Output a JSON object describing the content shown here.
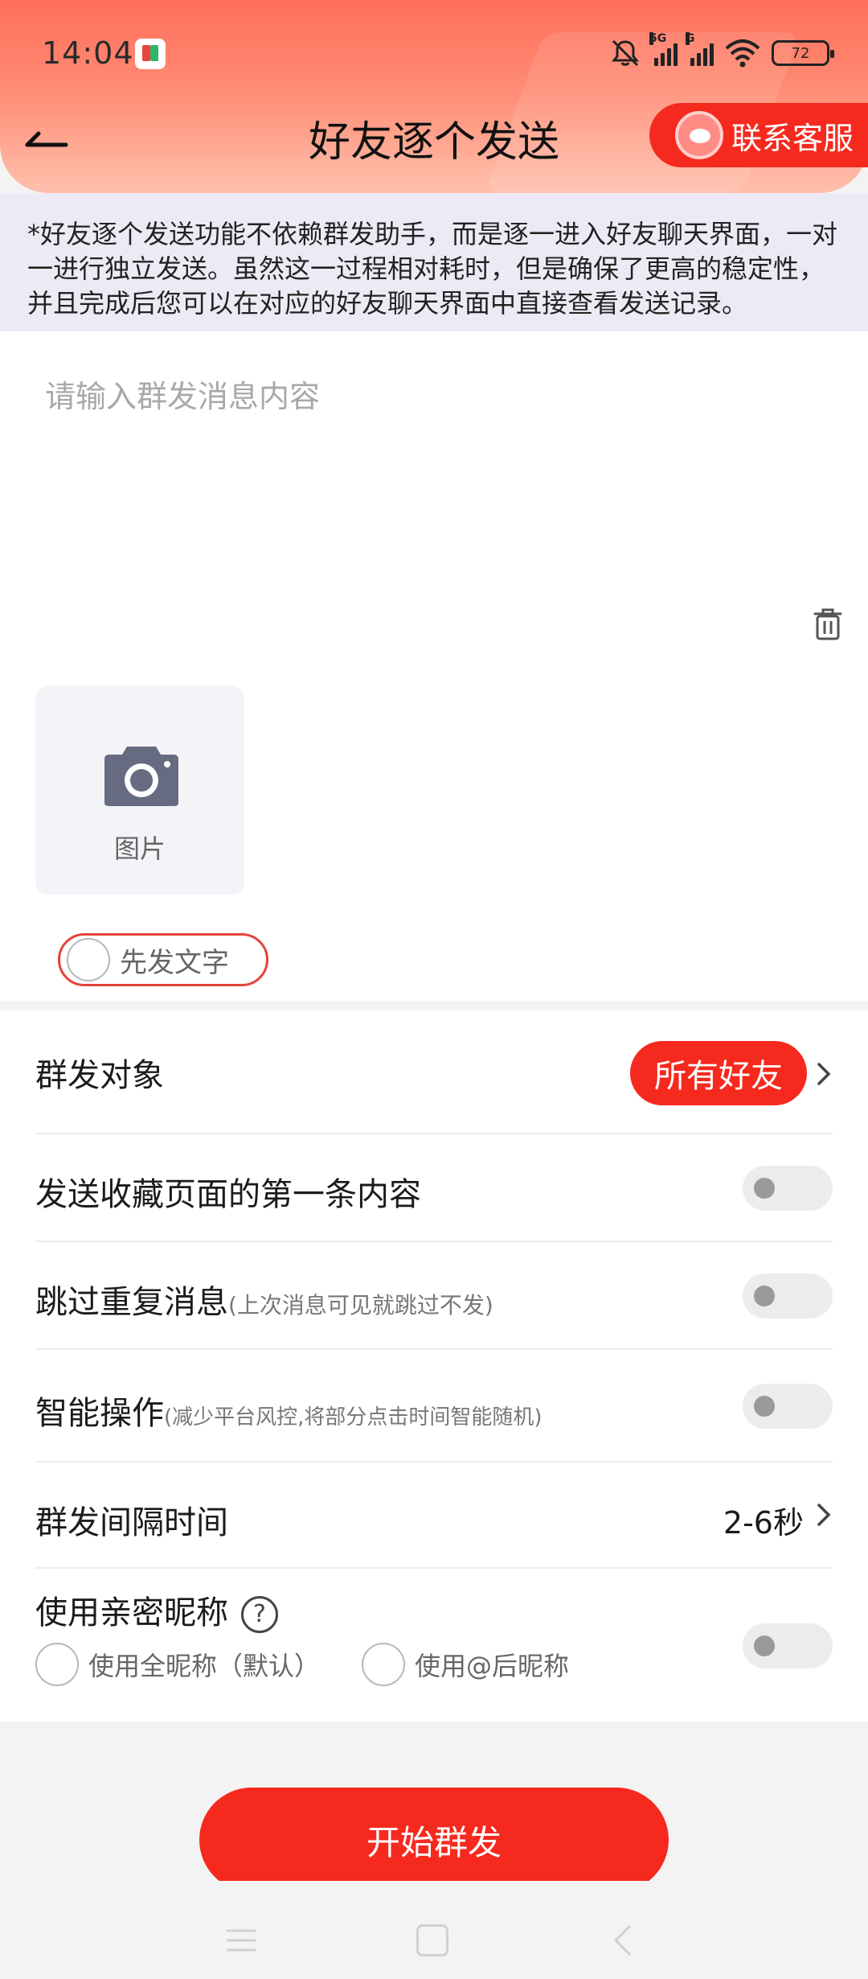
{
  "status_bar": {
    "time": "14:04",
    "signal_1_label": "5G",
    "signal_2_label": "G",
    "battery": "72"
  },
  "header": {
    "title": "好友逐个发送",
    "customer_service_label": "联系客服",
    "background_color": "#ff6f5c"
  },
  "notice": {
    "text": "*好友逐个发送功能不依赖群发助手，而是逐一进入好友聊天界面，一对一进行独立发送。虽然这一过程相对耗时，但是确保了更高的稳定性，并且完成后您可以在对应的好友聊天界面中直接查看发送记录。"
  },
  "composer": {
    "message_value": "",
    "message_placeholder": "请输入群发消息内容",
    "photo_label": "图片",
    "text_first_label": "先发文字"
  },
  "settings": {
    "target": {
      "label": "群发对象",
      "value": "所有好友"
    },
    "send_favorite_first": {
      "label": "发送收藏页面的第一条内容",
      "enabled": false
    },
    "skip_duplicate": {
      "label": "跳过重复消息",
      "sub": "(上次消息可见就跳过不发)",
      "enabled": false
    },
    "smart_operation": {
      "label": "智能操作",
      "sub": "(减少平台风控,将部分点击时间智能随机)",
      "enabled": false
    },
    "interval": {
      "label": "群发间隔时间",
      "value": "2-6秒"
    },
    "intimate_nickname": {
      "label": "使用亲密昵称",
      "help_glyph": "?",
      "enabled": false,
      "options": [
        "使用全昵称（默认）",
        "使用@后昵称"
      ]
    }
  },
  "actions": {
    "start_label": "开始群发",
    "accent_color": "#f6291e"
  },
  "icons": [
    "back-arrow-icon",
    "mute-icon",
    "wifi-icon",
    "battery-icon",
    "headset-icon",
    "trash-icon",
    "camera-icon",
    "chevron-right-icon",
    "help-icon",
    "menu-icon",
    "home-icon",
    "back-icon"
  ]
}
